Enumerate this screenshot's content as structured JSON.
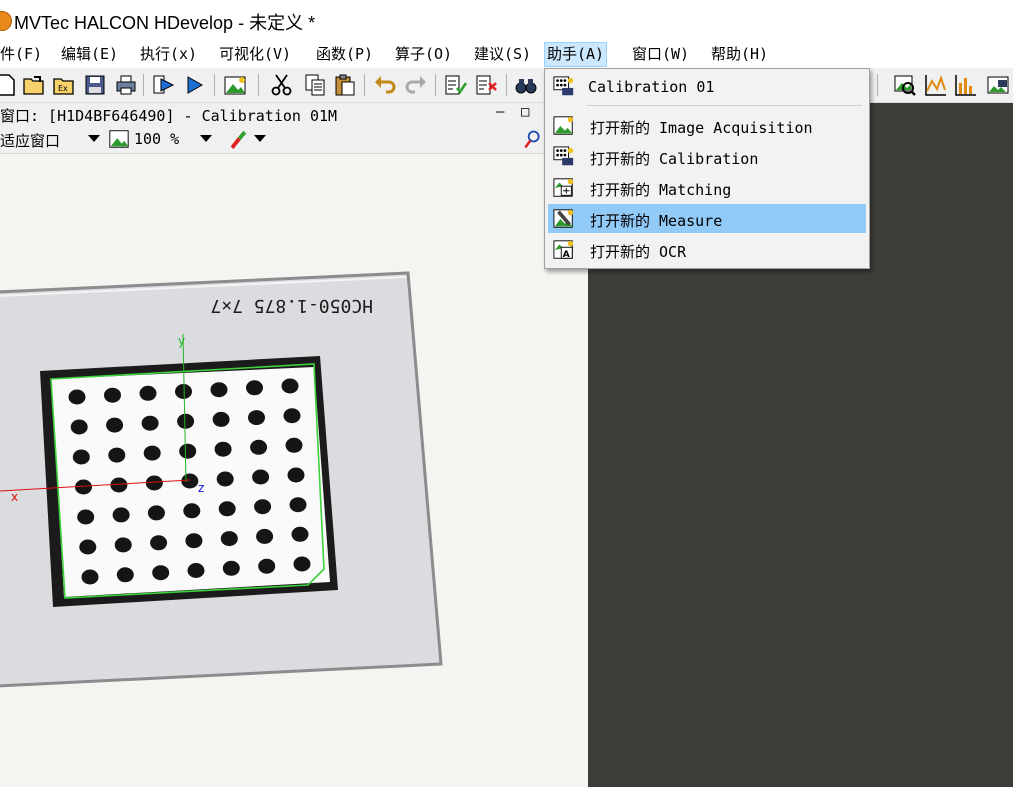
{
  "window": {
    "title": "MVTec HALCON HDevelop - 未定义 *"
  },
  "menubar": {
    "items": [
      {
        "label": "件(F)"
      },
      {
        "label": "编辑(E)"
      },
      {
        "label": "执行(x)"
      },
      {
        "label": "可视化(V)"
      },
      {
        "label": "函数(P)"
      },
      {
        "label": "算子(O)"
      },
      {
        "label": "建议(S)"
      },
      {
        "label": "助手(A)",
        "active": true
      },
      {
        "label": "窗口(W)"
      },
      {
        "label": "帮助(H)"
      }
    ]
  },
  "graphics_window": {
    "title": "窗口: [H1D4BF646490] - Calibration 01M",
    "minimize_symbol": "–",
    "maximize_symbol": "□",
    "fit_mode": "适应窗口",
    "zoom": "100 %"
  },
  "calibration_plate": {
    "label": "HC050-1.875 7×7",
    "axis_x": "x",
    "axis_y": "y",
    "axis_z": "z",
    "rows": 7,
    "cols": 7
  },
  "assistants_menu": {
    "items": [
      {
        "label": "Calibration 01",
        "icon": "calibration-icon"
      },
      {
        "label": "打开新的 Image Acquisition",
        "icon": "image-acquisition-icon"
      },
      {
        "label": "打开新的 Calibration",
        "icon": "calibration-icon"
      },
      {
        "label": "打开新的 Matching",
        "icon": "matching-icon"
      },
      {
        "label": "打开新的 Measure",
        "icon": "measure-icon",
        "highlighted": true
      },
      {
        "label": "打开新的 OCR",
        "icon": "ocr-icon"
      }
    ]
  },
  "colors": {
    "accent_highlight": "#91c9f7",
    "active_menu": "#cce8ff",
    "dark_panel": "#3c3c38",
    "contour_green": "#3cd23c",
    "axis_red": "#e01010",
    "axis_blue": "#1010e0"
  }
}
